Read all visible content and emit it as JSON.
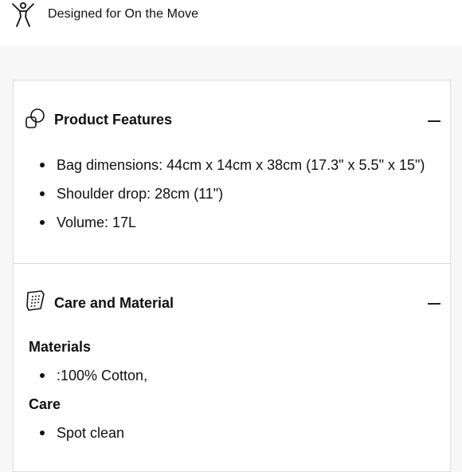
{
  "banner": {
    "text": "Designed for On the Move",
    "icon": "person-arms-up-icon"
  },
  "product_features": {
    "title": "Product Features",
    "icon": "overlapping-shapes-icon",
    "toggle": "—",
    "items": [
      "Bag dimensions: 44cm x 14cm x 38cm (17.3\" x 5.5\" x 15\")",
      "Shoulder drop: 28cm (11\")",
      "Volume: 17L"
    ]
  },
  "care_material": {
    "title": "Care and Material",
    "icon": "fabric-swatch-icon",
    "toggle": "—",
    "materials_label": "Materials",
    "materials": [
      ":100% Cotton,"
    ],
    "care_label": "Care",
    "care": [
      "Spot clean"
    ]
  }
}
